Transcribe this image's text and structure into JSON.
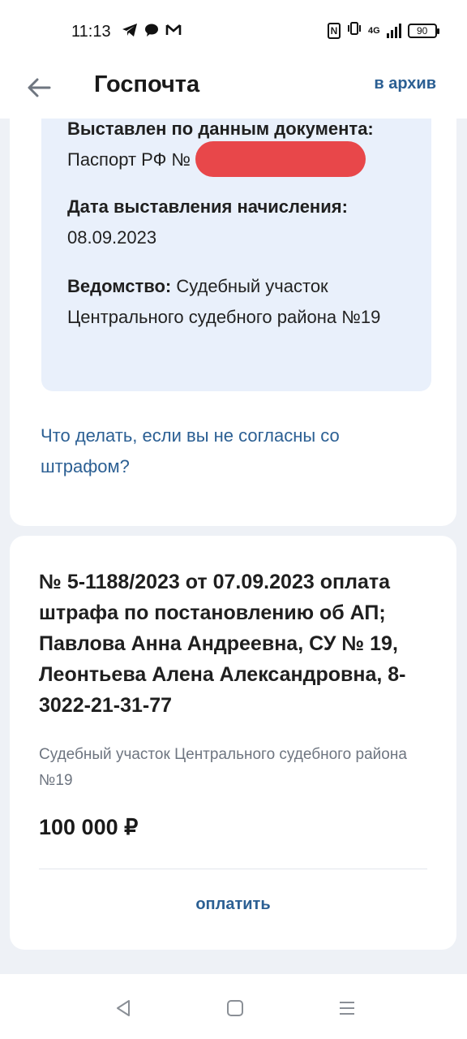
{
  "status_bar": {
    "time": "11:13",
    "signal": "4G",
    "battery": "90",
    "nfc": "N"
  },
  "header": {
    "title": "Госпочта",
    "archive_label": "в архив"
  },
  "details": {
    "issued_by_doc_label": "Выставлен по данным документа:",
    "issued_by_doc_value": "Паспорт РФ № 7",
    "date_label": "Дата выставления начисления:",
    "date_value": "08.09.2023",
    "agency_label": "Ведомство:",
    "agency_value": " Судебный участок Центрального судебного района №19"
  },
  "disagree_link": "Что делать, если вы не согласны со штрафом?",
  "fine": {
    "title": "№ 5-1188/2023 от 07.09.2023 оплата штрафа по постановлению об АП; Павлова Анна Андреевна, СУ № 19, Леонтьева Алена Александровна, 8-3022-21-31-77",
    "organization": "Судебный участок Центрального судебного района №19",
    "amount": "100 000 ₽",
    "pay_label": "оплатить"
  },
  "colors": {
    "accent": "#2b5f93",
    "info_bg": "#e9f0fb",
    "redaction": "#e8474a",
    "page_bg": "#eef1f6"
  }
}
